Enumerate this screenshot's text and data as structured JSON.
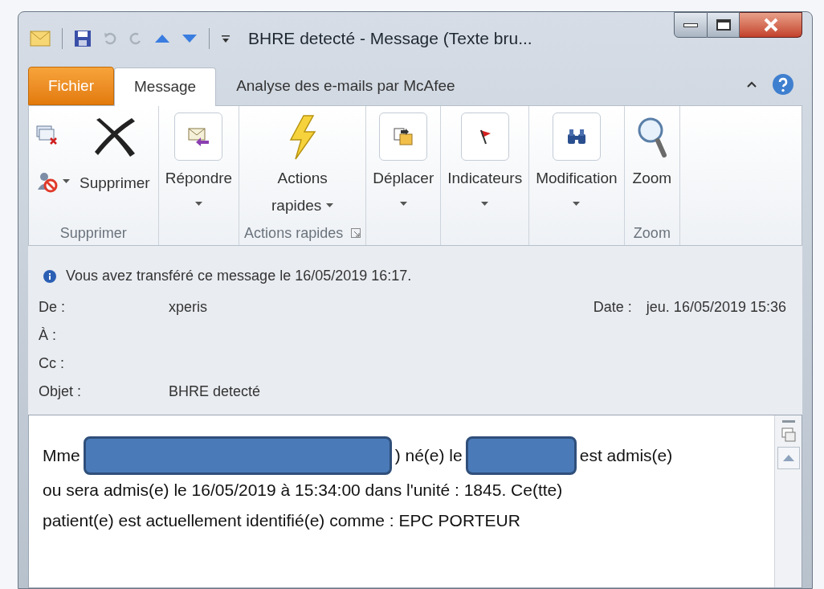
{
  "window": {
    "title": "BHRE detecté  - Message (Texte bru..."
  },
  "tabs": [
    {
      "label": "Fichier",
      "kind": "file",
      "selected": false
    },
    {
      "label": "Message",
      "kind": "tab",
      "selected": true
    },
    {
      "label": "Analyse des e-mails par McAfee",
      "kind": "tab",
      "selected": false
    }
  ],
  "ribbon_groups": [
    {
      "label": "Supprimer",
      "buttons": [
        {
          "kind": "small",
          "dropdown": false
        },
        {
          "kind": "small",
          "dropdown": true
        },
        {
          "kind": "large",
          "label": "Supprimer",
          "dropdown": false
        }
      ]
    },
    {
      "buttons": [
        {
          "kind": "framed",
          "label": "Répondre",
          "dropdown": true
        }
      ]
    },
    {
      "label": "Actions rapides",
      "launcher": true,
      "buttons": [
        {
          "kind": "large",
          "label": "Actions",
          "label2": "rapides",
          "dropdown": true
        }
      ]
    },
    {
      "buttons": [
        {
          "kind": "framed",
          "label": "Déplacer",
          "dropdown": true
        }
      ]
    },
    {
      "buttons": [
        {
          "kind": "framed",
          "label": "Indicateurs",
          "dropdown": true
        }
      ]
    },
    {
      "buttons": [
        {
          "kind": "framed",
          "label": "Modification",
          "dropdown": true
        }
      ]
    },
    {
      "label": "Zoom",
      "buttons": [
        {
          "kind": "large",
          "label": "Zoom",
          "dropdown": false
        }
      ]
    }
  ],
  "info_bar": "Vous avez transféré ce message le 16/05/2019 16:17.",
  "header": {
    "fields": [
      {
        "label": "De :",
        "value": "xperis"
      },
      {
        "label": "À :"
      },
      {
        "label": "Cc :"
      },
      {
        "label": "Objet :",
        "value": "BHRE detecté"
      }
    ],
    "date": {
      "label": "Date :",
      "value": "jeu. 16/05/2019 15:36"
    }
  },
  "body": {
    "lines": [
      [
        {
          "kind": "text",
          "text": "Mme"
        },
        {
          "kind": "redaction"
        },
        {
          "kind": "text",
          "text": ") né(e) le"
        },
        {
          "kind": "redaction"
        },
        {
          "kind": "text",
          "text": "est admis(e)"
        }
      ],
      [
        {
          "kind": "text",
          "text": "ou sera admis(e) le 16/05/2019 à 15:34:00 dans l'unité : 1845. Ce(tte)"
        }
      ],
      [
        {
          "kind": "text",
          "text": "patient(e) est actuellement identifié(e) comme : EPC PORTEUR"
        }
      ]
    ]
  }
}
